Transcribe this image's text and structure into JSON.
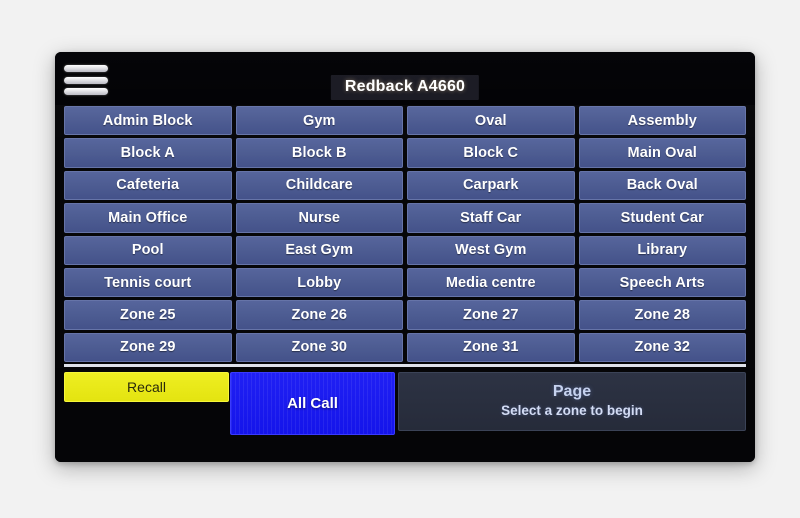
{
  "screen": {
    "title": "Redback A4660",
    "menu_icon": "hamburger-menu-icon"
  },
  "zones": [
    {
      "label": "Admin Block"
    },
    {
      "label": "Gym"
    },
    {
      "label": "Oval"
    },
    {
      "label": "Assembly"
    },
    {
      "label": "Block A"
    },
    {
      "label": "Block B"
    },
    {
      "label": "Block C"
    },
    {
      "label": "Main Oval"
    },
    {
      "label": "Cafeteria"
    },
    {
      "label": "Childcare"
    },
    {
      "label": "Carpark"
    },
    {
      "label": "Back Oval"
    },
    {
      "label": "Main Office"
    },
    {
      "label": "Nurse"
    },
    {
      "label": "Staff Car"
    },
    {
      "label": "Student Car"
    },
    {
      "label": "Pool"
    },
    {
      "label": "East Gym"
    },
    {
      "label": "West Gym"
    },
    {
      "label": "Library"
    },
    {
      "label": "Tennis court"
    },
    {
      "label": "Lobby"
    },
    {
      "label": "Media centre"
    },
    {
      "label": "Speech Arts"
    },
    {
      "label": "Zone 25"
    },
    {
      "label": "Zone 26"
    },
    {
      "label": "Zone 27"
    },
    {
      "label": "Zone 28"
    },
    {
      "label": "Zone 29"
    },
    {
      "label": "Zone 30"
    },
    {
      "label": "Zone 31"
    },
    {
      "label": "Zone 32"
    }
  ],
  "actions": {
    "recall": "Recall",
    "all_call": "All Call",
    "page_title": "Page",
    "page_subtitle": "Select a zone to begin"
  },
  "colors": {
    "background": "#f2f2f2",
    "bezel": "#060608",
    "zone_button": "#4d5c92",
    "recall_yellow": "#e4e410",
    "all_call_blue": "#1414ea",
    "page_panel": "#2d3344",
    "title_text": "#ffffff"
  }
}
